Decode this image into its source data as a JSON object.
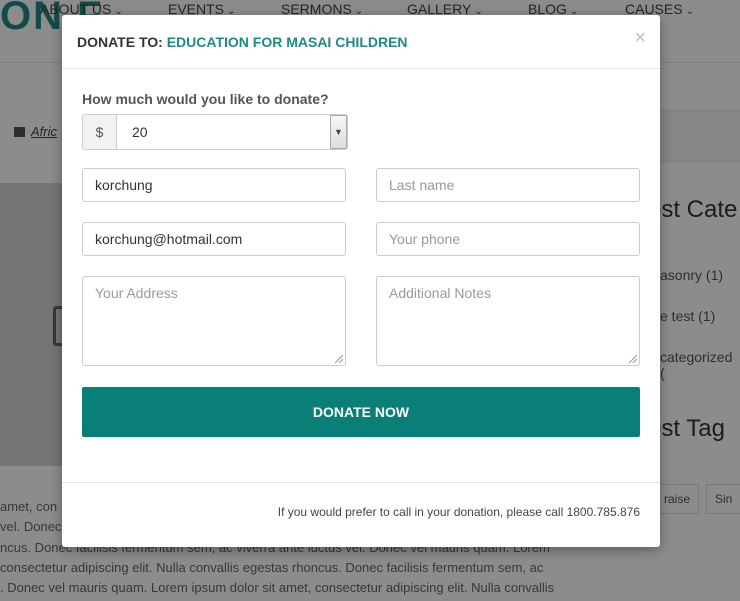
{
  "background": {
    "logo_text": "ON F",
    "nav": [
      {
        "label": "ABOUT US"
      },
      {
        "label": "EVENTS"
      },
      {
        "label": "SERMONS"
      },
      {
        "label": "GALLERY"
      },
      {
        "label": "BLOG"
      },
      {
        "label": "CAUSES"
      }
    ],
    "category_link": "Afric",
    "widget_titles": [
      "ost Cate",
      "ost Tag"
    ],
    "category_links": [
      "asonry (1)",
      "e test (1)",
      "categorized ("
    ],
    "tags": [
      "raise",
      "Sin"
    ],
    "paragraph_lines": [
      "amet, con",
      "vel. Donec",
      "ncus. Donec facilisis fermentum sem, ac viverra ante luctus vel. Donec vel mauris quam. Lorem",
      "consectetur adipiscing elit. Nulla convallis egestas rhoncus. Donec facilisis fermentum sem, ac",
      ". Donec vel mauris quam. Lorem ipsum dolor sit amet, consectetur adipiscing elit. Nulla convallis"
    ]
  },
  "modal": {
    "title_prefix": "DONATE TO:",
    "title_cause": "EDUCATION FOR MASAI CHILDREN",
    "close_label": "×",
    "amount_question": "How much would you like to donate?",
    "currency_symbol": "$",
    "amount_value": "20",
    "first_name_value": "korchung",
    "last_name_placeholder": "Last name",
    "email_value": "korchung@hotmail.com",
    "phone_placeholder": "Your phone",
    "address_placeholder": "Your Address",
    "notes_placeholder": "Additional Notes",
    "donate_button": "DONATE NOW",
    "footer_text": "If you would prefer to call in your donation, please call 1800.785.876"
  },
  "colors": {
    "accent": "#1f8a85",
    "button": "#0a7f78"
  }
}
